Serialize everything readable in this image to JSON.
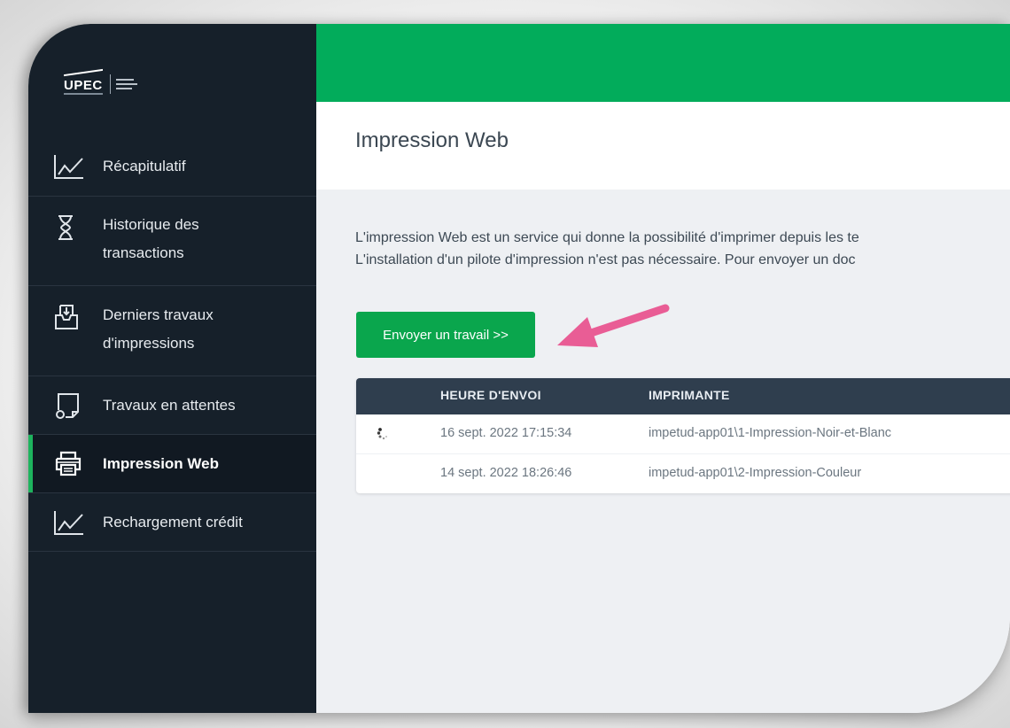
{
  "sidebar": {
    "logo_text": "UPEC",
    "items": [
      {
        "label": "Récapitulatif",
        "icon": "line-chart-icon"
      },
      {
        "label": "Historique des transactions",
        "icon": "hourglass-icon"
      },
      {
        "label": "Derniers travaux d'impressions",
        "icon": "inbox-tray-icon"
      },
      {
        "label": "Travaux en attentes",
        "icon": "pending-jobs-icon"
      },
      {
        "label": "Impression Web",
        "icon": "printer-icon",
        "active": true
      },
      {
        "label": "Rechargement crédit",
        "icon": "line-chart-icon"
      }
    ]
  },
  "header": {
    "title": "Impression Web"
  },
  "main": {
    "description_line1": "L'impression Web est un service qui donne la possibilité d'imprimer depuis les te",
    "description_line2": "L'installation d'un pilote d'impression n'est pas nécessaire. Pour envoyer un doc",
    "send_button": "Envoyer un travail >>",
    "table": {
      "headers": [
        "HEURE D'ENVOI",
        "IMPRIMANTE"
      ],
      "rows": [
        {
          "time": "16 sept. 2022 17:15:34",
          "printer": "impetud-app01\\1-Impression-Noir-et-Blanc",
          "loading": true
        },
        {
          "time": "14 sept. 2022 18:26:46",
          "printer": "impetud-app01\\2-Impression-Couleur",
          "loading": false
        }
      ]
    }
  },
  "colors": {
    "sidebar_bg": "#16202a",
    "topbar_green": "#02ac5b",
    "button_green": "#0aa64d",
    "table_header_bg": "#2f3e4e",
    "annotation_arrow": "#e95d95"
  }
}
